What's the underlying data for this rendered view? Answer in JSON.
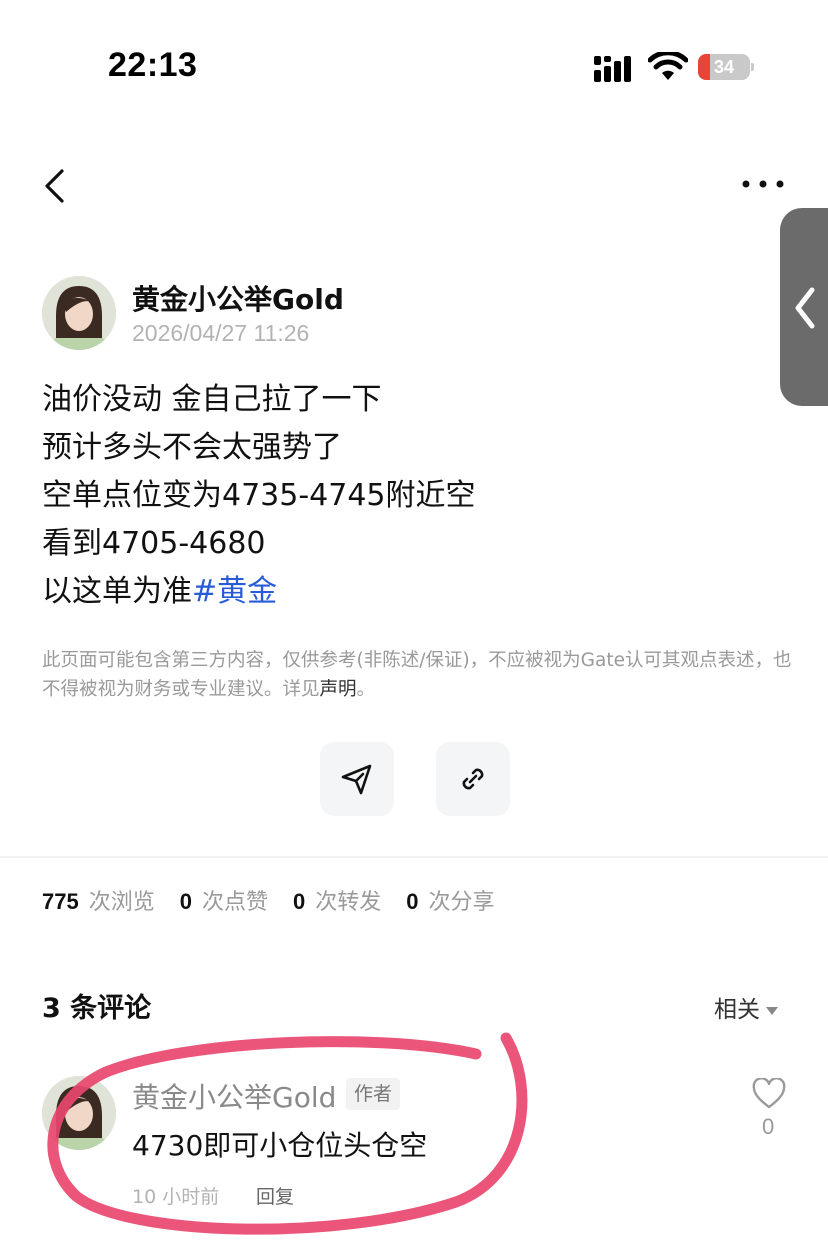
{
  "status_bar": {
    "time": "22:13",
    "battery_level": "34"
  },
  "nav": {
    "back_icon": "chevron-left-icon",
    "more_icon": "more-dots-icon",
    "side_tab_icon": "chevron-left-icon"
  },
  "post": {
    "author_name": "黄金小公举Gold",
    "timestamp": "2026/04/27 11:26",
    "lines": [
      "油价没动 金自己拉了一下",
      "预计多头不会太强势了",
      "空单点位变为4735-4745附近空",
      "看到4705-4680",
      "以这单为准"
    ],
    "hashtag": "#黄金",
    "disclaimer": "此页面可能包含第三方内容，仅供参考(非陈述/保证)，不应被视为Gate认可其观点表述，也不得被视为财务或专业建议。详见",
    "disclaimer_link": "声明",
    "disclaimer_end": "。"
  },
  "actions": {
    "share_icon": "send-icon",
    "link_icon": "link-icon"
  },
  "stats": {
    "views": "775",
    "views_label": "次浏览",
    "likes": "0",
    "likes_label": "次点赞",
    "reposts": "0",
    "reposts_label": "次转发",
    "shares": "0",
    "shares_label": "次分享"
  },
  "comments": {
    "title": "3 条评论",
    "sort_label": "相关",
    "items": [
      {
        "author": "黄金小公举Gold",
        "tag": "作者",
        "text": "4730即可小仓位头仓空",
        "time": "10 小时前",
        "reply_label": "回复",
        "like_count": "0"
      }
    ]
  },
  "colors": {
    "accent_link": "#2a5bd7",
    "annotation": "#e8466e",
    "battery_low": "#e8443a"
  }
}
